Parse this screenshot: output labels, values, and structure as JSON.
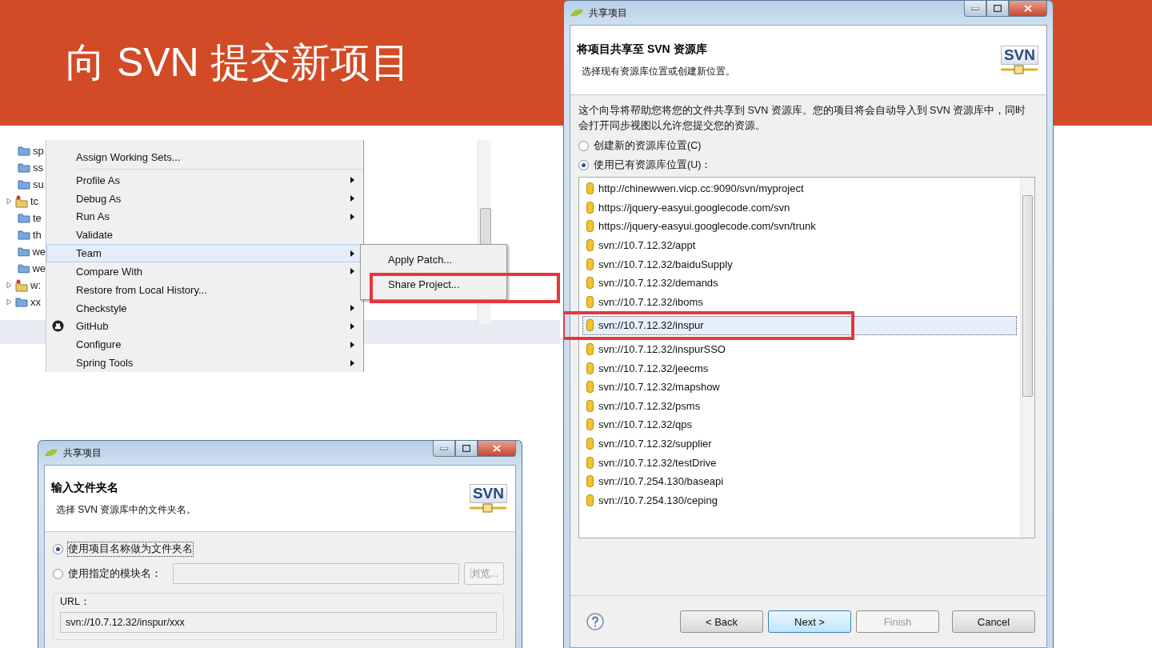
{
  "slide_title": "向 SVN 提交新项目",
  "ide_screenshot": {
    "tree_items": [
      {
        "label": "sp",
        "kind": "folder",
        "expandable": false
      },
      {
        "label": "ss",
        "kind": "folder",
        "expandable": false
      },
      {
        "label": "su",
        "kind": "folder",
        "expandable": false
      },
      {
        "label": "tc",
        "kind": "project",
        "expandable": true
      },
      {
        "label": "te",
        "kind": "folder",
        "expandable": false
      },
      {
        "label": "th",
        "kind": "folder",
        "expandable": false
      },
      {
        "label": "we",
        "kind": "folder",
        "expandable": false
      },
      {
        "label": "we",
        "kind": "folder",
        "expandable": false
      },
      {
        "label": "w:",
        "kind": "project",
        "expandable": true
      },
      {
        "label": "xx",
        "kind": "folder",
        "expandable": true
      }
    ],
    "menu_items": [
      {
        "label": "Assign Working Sets...",
        "kind": "plain",
        "has_submenu": false,
        "selected": false,
        "separator_after": true
      },
      {
        "label": "Profile As",
        "kind": "plain",
        "has_submenu": true,
        "selected": false,
        "separator_after": false
      },
      {
        "label": "Debug As",
        "kind": "plain",
        "has_submenu": true,
        "selected": false,
        "separator_after": false
      },
      {
        "label": "Run As",
        "kind": "plain",
        "has_submenu": true,
        "selected": false,
        "separator_after": false
      },
      {
        "label": "Validate",
        "kind": "plain",
        "has_submenu": false,
        "selected": false,
        "separator_after": false
      },
      {
        "label": "Team",
        "kind": "plain",
        "has_submenu": true,
        "selected": true,
        "separator_after": false
      },
      {
        "label": "Compare With",
        "kind": "plain",
        "has_submenu": true,
        "selected": false,
        "separator_after": false
      },
      {
        "label": "Restore from Local History...",
        "kind": "plain",
        "has_submenu": false,
        "selected": false,
        "separator_after": false
      },
      {
        "label": "Checkstyle",
        "kind": "plain",
        "has_submenu": true,
        "selected": false,
        "separator_after": false
      },
      {
        "label": "GitHub",
        "kind": "github",
        "has_submenu": true,
        "selected": false,
        "separator_after": false
      },
      {
        "label": "Configure",
        "kind": "plain",
        "has_submenu": true,
        "selected": false,
        "separator_after": false
      },
      {
        "label": "Spring Tools",
        "kind": "plain",
        "has_submenu": true,
        "selected": false,
        "separator_after": false
      }
    ],
    "submenu_items": [
      {
        "label": "Apply Patch...",
        "annotated": false
      },
      {
        "label": "Share Project...",
        "annotated": true
      }
    ]
  },
  "share_dialog": {
    "title": "共享项目",
    "heading": "将项目共享至 SVN 资源库",
    "subtitle": "选择现有资源库位置或创建新位置。",
    "logo_text": "SVN",
    "description": "这个向导将帮助您将您的文件共享到 SVN 资源库。您的项目将会自动导入到 SVN 资源库中，同时会打开同步视图以允许您提交您的资源。",
    "radios": [
      {
        "label": "创建新的资源库位置(C)",
        "selected": false
      },
      {
        "label": "使用已有资源库位置(U)：",
        "selected": true
      }
    ],
    "repositories": [
      {
        "url": "http://chinewwen.vicp.cc:9090/svn/myproject",
        "selected": false,
        "annotated": false
      },
      {
        "url": "https://jquery-easyui.googlecode.com/svn",
        "selected": false,
        "annotated": false
      },
      {
        "url": "https://jquery-easyui.googlecode.com/svn/trunk",
        "selected": false,
        "annotated": false
      },
      {
        "url": "svn://10.7.12.32/appt",
        "selected": false,
        "annotated": false
      },
      {
        "url": "svn://10.7.12.32/baiduSupply",
        "selected": false,
        "annotated": false
      },
      {
        "url": "svn://10.7.12.32/demands",
        "selected": false,
        "annotated": false
      },
      {
        "url": "svn://10.7.12.32/iboms",
        "selected": false,
        "annotated": false
      },
      {
        "url": "svn://10.7.12.32/inspur",
        "selected": true,
        "annotated": true
      },
      {
        "url": "svn://10.7.12.32/inspurSSO",
        "selected": false,
        "annotated": false
      },
      {
        "url": "svn://10.7.12.32/jeecms",
        "selected": false,
        "annotated": false
      },
      {
        "url": "svn://10.7.12.32/mapshow",
        "selected": false,
        "annotated": false
      },
      {
        "url": "svn://10.7.12.32/psms",
        "selected": false,
        "annotated": false
      },
      {
        "url": "svn://10.7.12.32/qps",
        "selected": false,
        "annotated": false
      },
      {
        "url": "svn://10.7.12.32/supplier",
        "selected": false,
        "annotated": false
      },
      {
        "url": "svn://10.7.12.32/testDrive",
        "selected": false,
        "annotated": false
      },
      {
        "url": "svn://10.7.254.130/baseapi",
        "selected": false,
        "annotated": false
      },
      {
        "url": "svn://10.7.254.130/ceping",
        "selected": false,
        "annotated": false
      }
    ],
    "buttons": [
      {
        "label": "< Back",
        "default": false,
        "disabled": false
      },
      {
        "label": "Next >",
        "default": true,
        "disabled": false
      },
      {
        "label": "Finish",
        "default": false,
        "disabled": true
      },
      {
        "label": "Cancel",
        "default": false,
        "disabled": false
      }
    ]
  },
  "folder_dialog": {
    "title": "共享项目",
    "heading": "输入文件夹名",
    "subtitle": "选择 SVN 资源库中的文件夹名。",
    "logo_text": "SVN",
    "radios": [
      {
        "label": "使用项目名称做为文件夹名",
        "selected": true
      },
      {
        "label": "使用指定的模块名：",
        "selected": false
      }
    ],
    "browse_button": {
      "label": "浏览...",
      "disabled": true
    },
    "url_label": "URL：",
    "url_value": "svn://10.7.12.32/inspur/xxx"
  }
}
